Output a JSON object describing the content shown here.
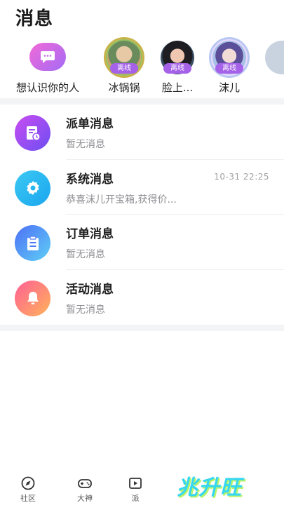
{
  "header": {
    "title": "消息"
  },
  "friends": {
    "intro_label": "想认识你的人",
    "status_label": "离线",
    "items": [
      {
        "name": "冰锅锅"
      },
      {
        "name": "脸上..."
      },
      {
        "name": "沫儿"
      }
    ]
  },
  "messages": [
    {
      "title": "派单消息",
      "subtitle": "暂无消息",
      "time": "",
      "icon": "dispatch-doc-icon",
      "color": "#8a4ef3"
    },
    {
      "title": "系统消息",
      "subtitle": "恭喜沫儿开宝箱,获得价...",
      "time": "10-31 22:25",
      "icon": "gear-icon",
      "color": "#27b7f0"
    },
    {
      "title": "订单消息",
      "subtitle": "暂无消息",
      "time": "",
      "icon": "clipboard-icon",
      "color": "#4f7cf5"
    },
    {
      "title": "活动消息",
      "subtitle": "暂无消息",
      "time": "",
      "icon": "bell-icon",
      "color": "#ff7a7a"
    }
  ],
  "tabbar": {
    "items": [
      {
        "label": "社区",
        "icon": "compass-icon"
      },
      {
        "label": "大神",
        "icon": "gamepad-icon"
      },
      {
        "label": "派",
        "icon": "play-icon"
      }
    ]
  },
  "watermark": "兆升旺"
}
